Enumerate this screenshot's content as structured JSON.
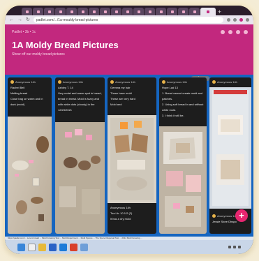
{
  "browser": {
    "url": "padlet.com/.../1a-mouldy-bread-pictures",
    "tab_count": 17
  },
  "header": {
    "breadcrumb": "Padlet • 3b • 1c",
    "title": "1A Moldy Bread Pictures",
    "subtitle": "Show off our moldy bread pictures"
  },
  "board": {
    "column_options_label": "⋮ ...",
    "add_post_label": "+"
  },
  "posts": [
    {
      "author": "Anonymous 14h",
      "lines": [
        "Rachel Bell",
        "Melting bread",
        "Close bag on warm and in",
        "dark (mold)"
      ]
    },
    {
      "author": "Anonymous 14h",
      "lines": [
        "Ashley T. 14",
        "Very moist and warm spot in bread,",
        "bread in bread. Mold is fuzzy and",
        "with white dots (cloudy) in the",
        "12/23/2021"
      ]
    },
    {
      "author": "Anonymous 14h",
      "lines": [
        "Gemma my hair",
        "These have mold",
        "These are very hard",
        "Mold and"
      ]
    },
    {
      "author": "Anonymous 14h",
      "lines": [
        "Hope Lad 13",
        "1. Bread cannot create mold and",
        "patches.",
        "2. Using soft bread in and without",
        "white mold.",
        "3. I think it will be."
      ]
    },
    {
      "author": "Anonymous 14h",
      "lines": []
    },
    {
      "author": "Anonymous 14h",
      "lines": [
        "Toa Lb: 10 1/2 (2)",
        "lt has a dry mold"
      ]
    },
    {
      "author": "Anonymous 14h",
      "lines": [
        "Jessie Store Dhapo"
      ]
    }
  ],
  "statusbar": "https://padlet.com/... Lorem bread ... Mold Growing Test ... Mold Experiment ... Mold Spores ... The Spore Dispersal Test ... 2014 Mold Growing ...",
  "colors": {
    "header": "#c2287e",
    "board": "#1565c0",
    "card": "#1d1d1d",
    "fab": "#e6266f"
  }
}
